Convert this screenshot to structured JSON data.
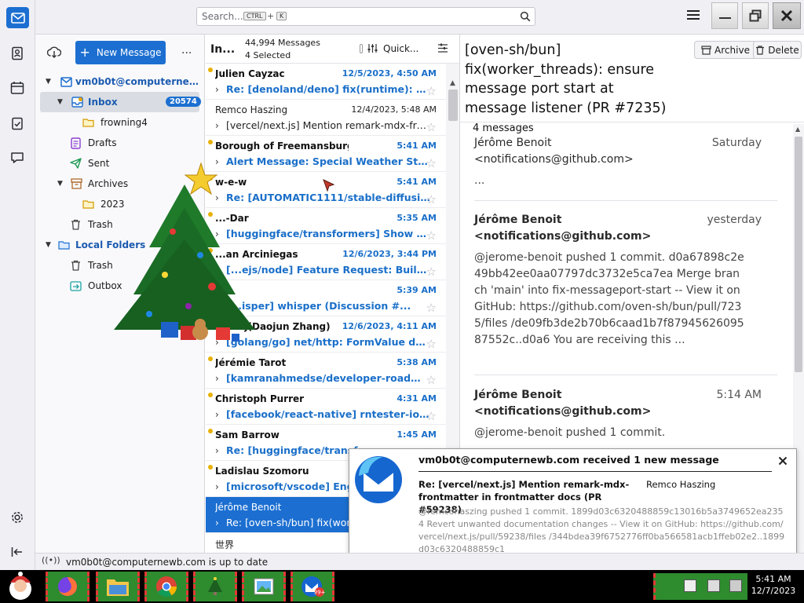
{
  "titlebar": {
    "search_placeholder": "Search...",
    "shortcut_ctrl": "CTRL",
    "shortcut_plus": "+",
    "shortcut_k": "K"
  },
  "folder_pane": {
    "new_message": "New Message",
    "more": "...",
    "account": "vm0b0t@computernewb.com",
    "folders": [
      {
        "name": "Inbox",
        "count": "20574"
      },
      {
        "name": "frowning4"
      },
      {
        "name": "Drafts"
      },
      {
        "name": "Sent"
      },
      {
        "name": "Archives"
      },
      {
        "name": "2023"
      },
      {
        "name": "Trash"
      },
      {
        "name": "Local Folders"
      },
      {
        "name": "Trash"
      },
      {
        "name": "Outbox"
      }
    ]
  },
  "thread_pane": {
    "folder_short": "In...",
    "message_count": "44,994 Messages",
    "selected_count": "4 Selected",
    "quick_filter": "Quick...",
    "rows": [
      {
        "from": "Julien Cayzac",
        "date": "12/5/2023, 4:50 AM",
        "subject": "Re: [denoland/deno] fix(runtime): H...",
        "unread": true
      },
      {
        "from": "Remco Haszing",
        "date": "12/4/2023, 5:48 AM",
        "subject": "[vercel/next.js] Mention remark-mdx-fro...",
        "unread": false
      },
      {
        "from": "Borough of Freemansburg",
        "date": "5:41 AM",
        "subject": "Alert Message: Special Weather Statem...",
        "unread": true
      },
      {
        "from": "w-e-w",
        "date": "5:41 AM",
        "subject": "Re: [AUTOMATIC1111/stable-diffusion-...",
        "unread": true
      },
      {
        "from": "...-Dar",
        "date": "5:35 AM",
        "subject": "[huggingface/transformers] Show ne...",
        "unread": true
      },
      {
        "from": "...an Arciniegas",
        "date": "12/6/2023, 3:44 PM",
        "subject": "[...ejs/node] Feature Request: Built-...",
        "unread": true
      },
      {
        "from": "",
        "date": "5:39 AM",
        "subject": "[...isper] whisper (Discussion #...",
        "unread": true
      },
      {
        "from": "...ezdj(Daojun Zhang)",
        "date": "12/6/2023, 4:11 AM",
        "subject": "[golang/go] net/http: FormValue doe...",
        "unread": true
      },
      {
        "from": "Jérémie Tarot",
        "date": "5:38 AM",
        "subject": "[kamranahmedse/developer-roadmap] [...",
        "unread": true
      },
      {
        "from": "Christoph Purrer",
        "date": "4:31 AM",
        "subject": "[facebook/react-native] rntester-ios : ...",
        "unread": true
      },
      {
        "from": "Sam Barrow",
        "date": "1:45 AM",
        "subject": "Re: [huggingface/transfo...",
        "unread": true
      },
      {
        "from": "Ladislau Szomoru",
        "date": "",
        "subject": "[microsoft/vscode] Enginee...",
        "unread": true
      },
      {
        "from": "Jérôme Benoit",
        "date": "",
        "subject": "Re: [oven-sh/bun] fix(work...",
        "unread": false,
        "selected": true
      },
      {
        "from": "世界",
        "date": "",
        "subject": "",
        "unread": false
      }
    ]
  },
  "reader": {
    "archive": "Archive",
    "delete": "Delete",
    "subject": "[oven-sh/bun] fix(worker_threads): ensure message port start at message listener (PR #7235)",
    "count": "4 messages",
    "messages": [
      {
        "from": "Jérôme Benoit <notifications@github.com>",
        "date": "Saturday",
        "body": "..."
      },
      {
        "from": "Jérôme Benoit <notifications@github.com>",
        "date": "yesterday",
        "body": "@jerome-benoit pushed 1 commit. d0a67898c2e49bb42ee0aa07797dc3732e5ca7ea Merge branch 'main' into fix-messageport-start -- View it on GitHub: https://github.com/oven-sh/bun/pull/7235/files /de09fb3de2b70b6caad1b7f8794562609587552c..d0a6 You are receiving this ..."
      },
      {
        "from": "Jérôme Benoit <notifications@github.com>",
        "date": "5:14 AM",
        "body": "@jerome-benoit pushed 1 commit."
      }
    ]
  },
  "notification": {
    "title": "vm0b0t@computernewb.com received 1 new message",
    "subject": "Re: [vercel/next.js] Mention remark-mdx-frontmatter in frontmatter docs (PR #59238)",
    "sender": "Remco Haszing",
    "preview": "@remcohaszing pushed 1 commit. 1899d03c6320488859c13016b5a3749652ea2354 Revert unwanted documentation changes -- View it on GitHub: https://github.com/vercel/next.js/pull/59238/files /344bdea39f6752776ff0ba566581acb1ffeb02e2..1899d03c6320488859c1"
  },
  "statusbar": {
    "text": "vm0b0t@computernewb.com is up to date"
  },
  "taskbar": {
    "time": "5:41 AM",
    "date": "12/7/2023"
  },
  "colors": {
    "accent": "#1c6fd1",
    "unread_blue": "#1a6fc9",
    "unread_dot": "#e8b000",
    "taskbar": "#000000"
  }
}
